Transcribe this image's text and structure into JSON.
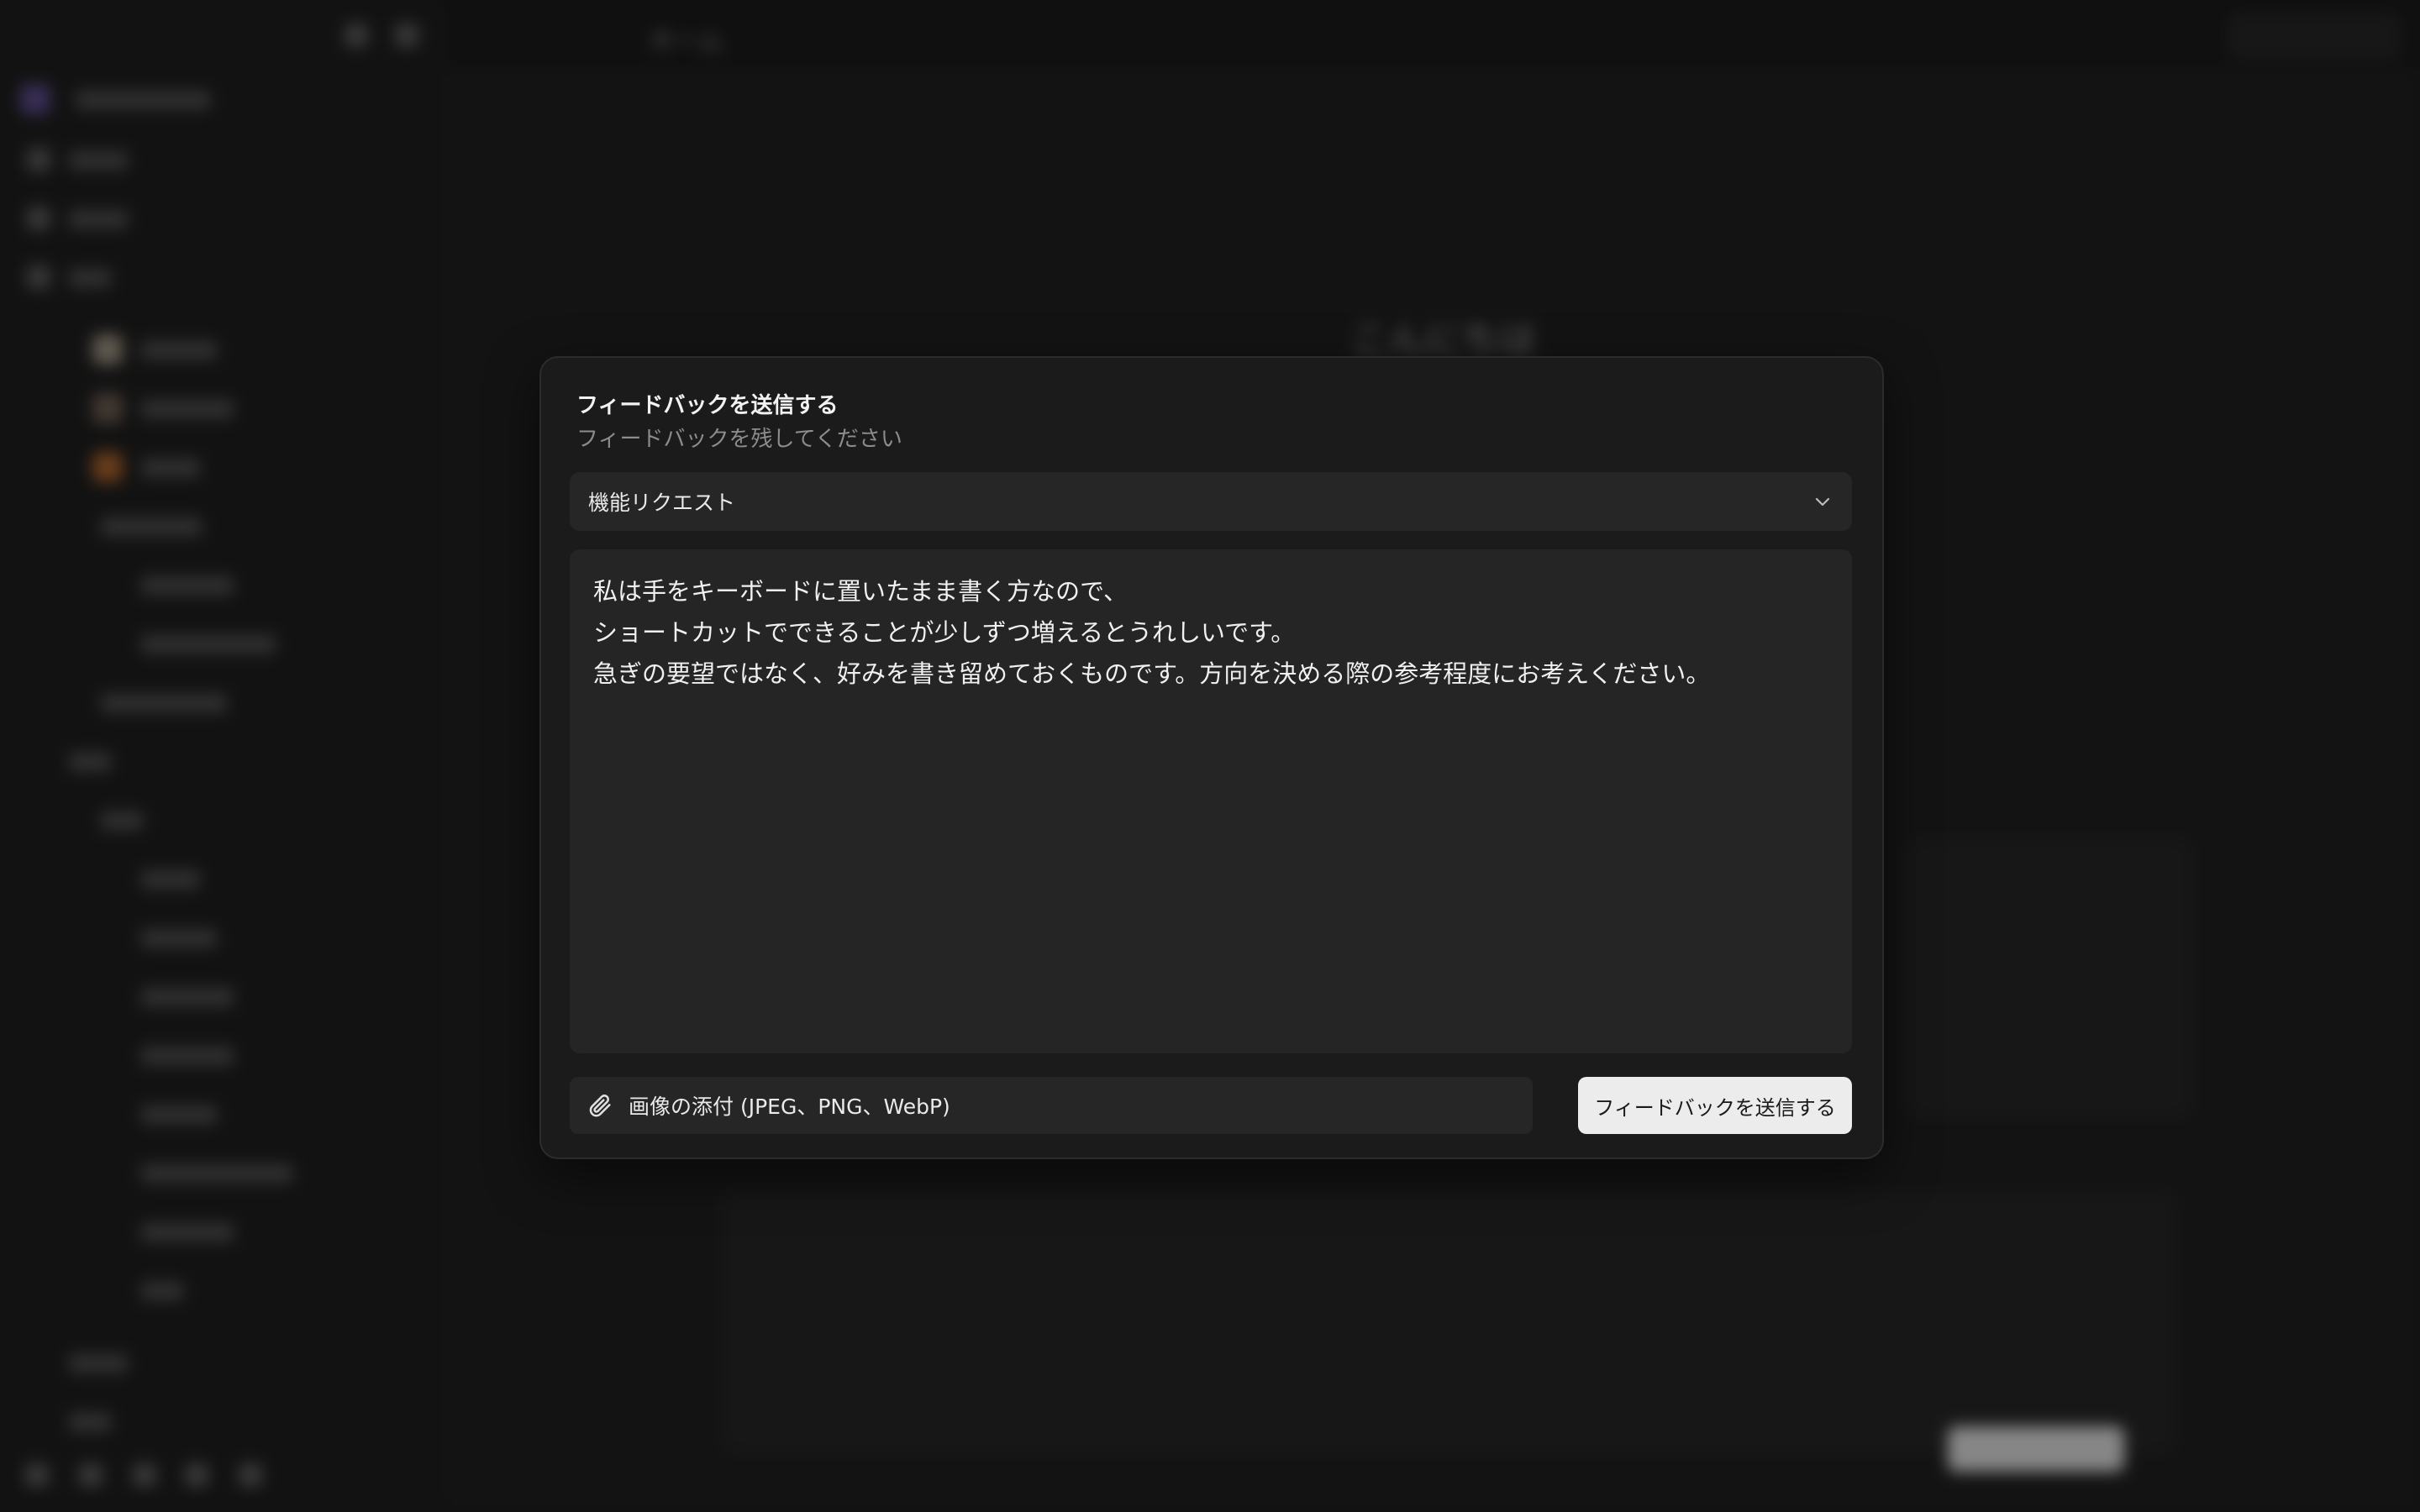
{
  "background": {
    "greeting": "こんにちは",
    "tab_title": "ホーム"
  },
  "modal": {
    "title": "フィードバックを送信する",
    "subtitle": "フィードバックを残してください",
    "category": {
      "selected": "機能リクエスト",
      "icon": "chevron-down-icon"
    },
    "message_lines": [
      "私は手をキーボードに置いたまま書く方なので、",
      "ショートカットでできることが少しずつ増えるとうれしいです。",
      "急ぎの要望ではなく、好みを書き留めておくものです。方向を決める際の参考程度にお考えください。"
    ],
    "attach": {
      "icon": "paperclip-icon",
      "label": "画像の添付 (JPEG、PNG、WebP)"
    },
    "submit_label": "フィードバックを送信する"
  },
  "colors": {
    "modal_background": "#1b1b1b",
    "field_background": "#262626",
    "submit_background": "#ececec"
  }
}
